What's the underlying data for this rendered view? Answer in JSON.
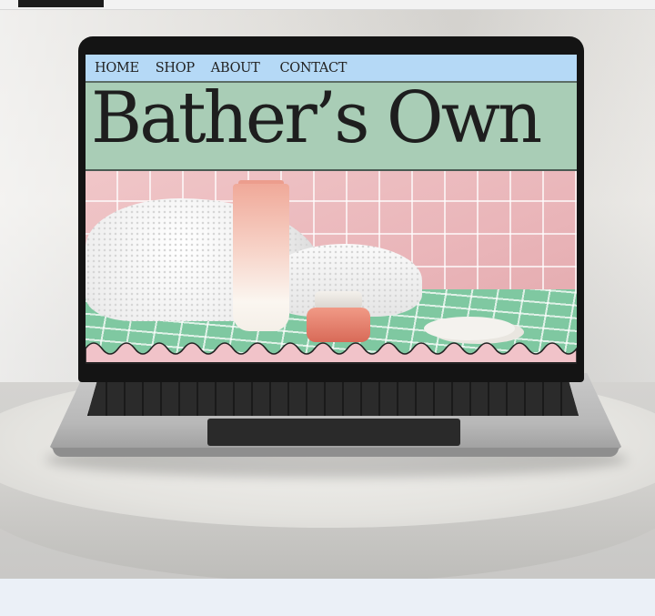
{
  "site": {
    "nav": [
      "HOME",
      "SHOP",
      "ABOUT",
      "CONTACT"
    ],
    "brand": "Bather’s Own"
  },
  "colors": {
    "nav_bg": "#b5d9f6",
    "hero_bg": "#a9cdb6",
    "tile_pink": "#f0c6c8",
    "tile_green": "#7fc8a1",
    "wave_pink": "#f1c3c9"
  },
  "icons": {
    "top_tab": "page-tab"
  }
}
